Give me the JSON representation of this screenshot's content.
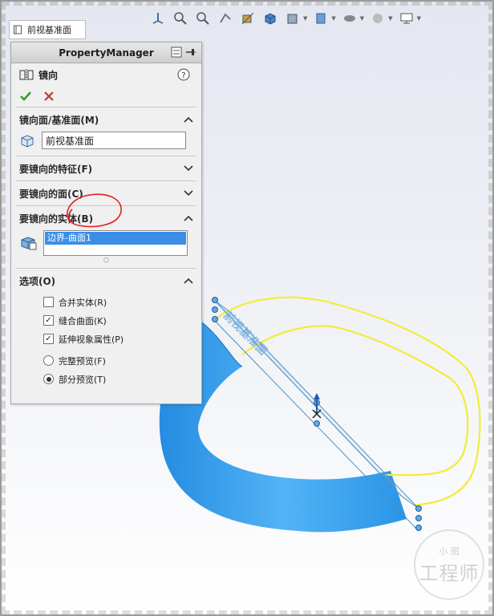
{
  "document": {
    "tab_label": "前视基准面"
  },
  "property_manager": {
    "header_title": "PropertyManager",
    "feature_name": "镜向",
    "groups": {
      "mirror_plane": {
        "title": "镜向面/基准面(M)",
        "value": "前视基准面"
      },
      "features": {
        "title": "要镜向的特征(F)"
      },
      "faces": {
        "title": "要镜向的面(C)"
      },
      "bodies": {
        "title": "要镜向的实体(B)",
        "selected_item": "边界-曲面1"
      },
      "options": {
        "title": "选项(O)",
        "merge_solids": {
          "label": "合并实体(R)",
          "checked": false
        },
        "knit_surfaces": {
          "label": "缝合曲面(K)",
          "checked": true
        },
        "propagate_visual": {
          "label": "延伸视象属性(P)",
          "checked": true
        },
        "full_preview": {
          "label": "完整预览(F)",
          "selected": false
        },
        "partial_preview": {
          "label": "部分预览(T)",
          "selected": true
        }
      }
    }
  },
  "viewport": {
    "plane_label": "前视基准面"
  },
  "watermark": {
    "line2": "工程师",
    "line1": "小 图"
  },
  "colors": {
    "selection_blue": "#3a8ee6",
    "surface_blue": "#1f8fe6",
    "sketch_yellow": "#f2ec3a",
    "ok_green": "#2e9e2e",
    "cancel_red": "#c0392b",
    "annotation_red": "#e02020"
  }
}
